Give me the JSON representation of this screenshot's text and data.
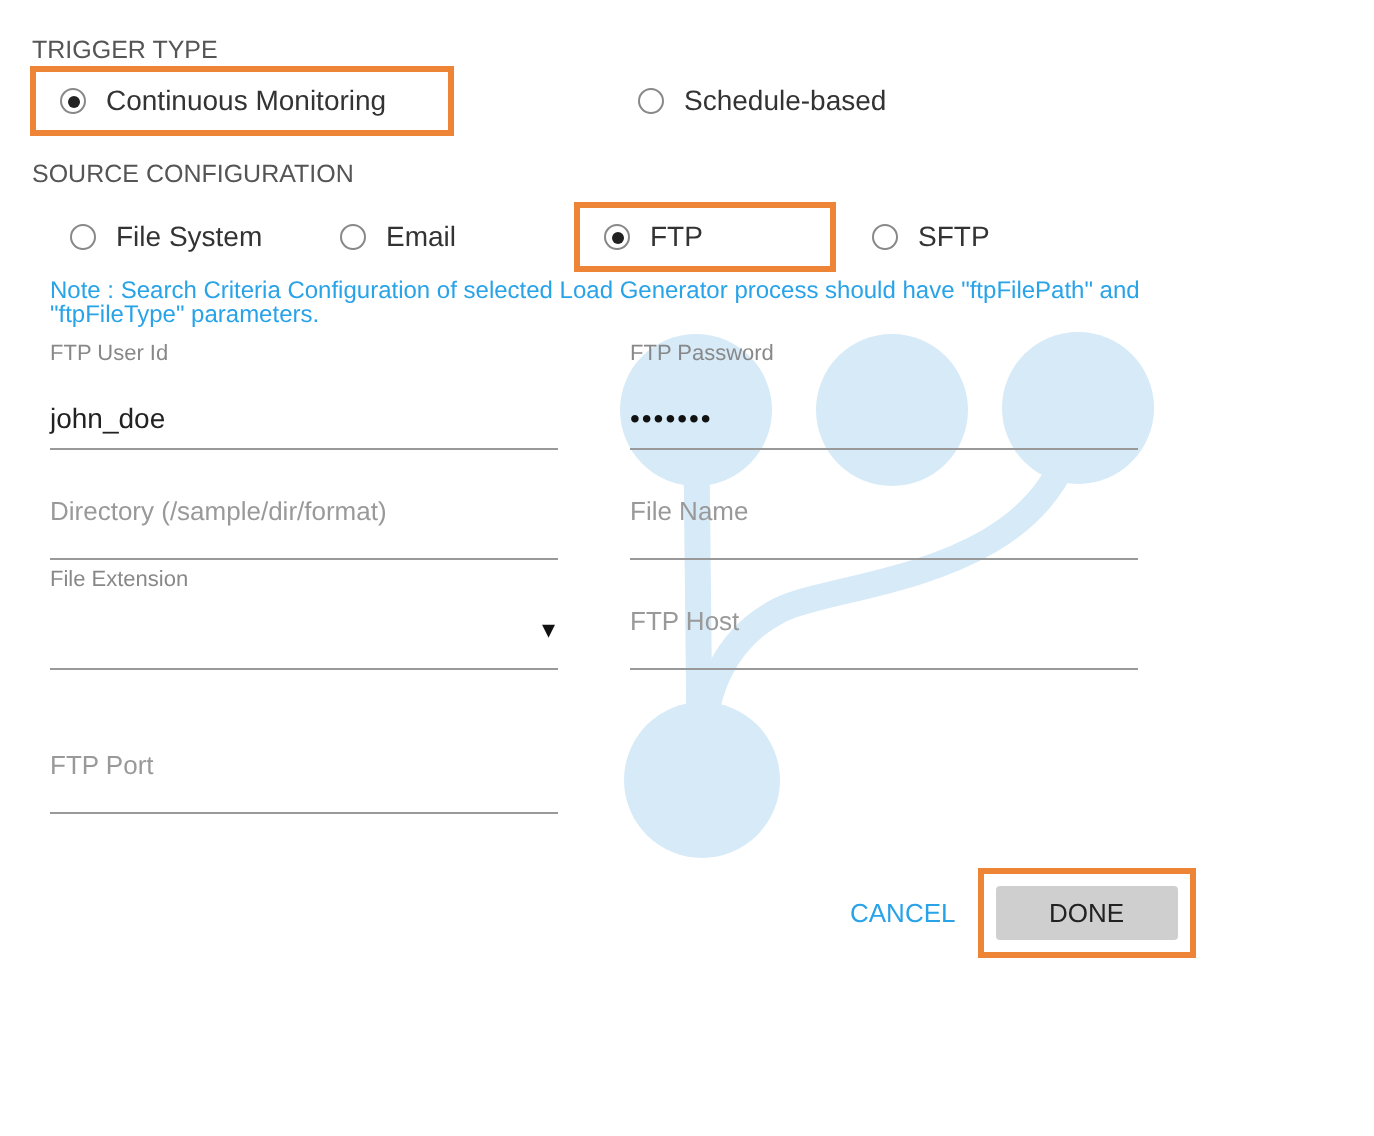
{
  "trigger_type": {
    "heading": "TRIGGER TYPE",
    "options": [
      {
        "label": "Continuous Monitoring",
        "selected": true,
        "highlighted": true
      },
      {
        "label": "Schedule-based",
        "selected": false,
        "highlighted": false
      }
    ]
  },
  "source_configuration": {
    "heading": "SOURCE CONFIGURATION",
    "options": [
      {
        "label": "File System",
        "selected": false,
        "highlighted": false
      },
      {
        "label": "Email",
        "selected": false,
        "highlighted": false
      },
      {
        "label": "FTP",
        "selected": true,
        "highlighted": true
      },
      {
        "label": "SFTP",
        "selected": false,
        "highlighted": false
      }
    ]
  },
  "note": "Note : Search Criteria Configuration of selected Load Generator process should have \"ftpFilePath\" and \"ftpFileType\" parameters.",
  "fields": [
    {
      "kind": "text",
      "label": "FTP User Id",
      "value": "john_doe"
    },
    {
      "kind": "password",
      "label": "FTP Password",
      "value": "•••••••"
    },
    {
      "kind": "empty",
      "placeholder": "Directory (/sample/dir/format)"
    },
    {
      "kind": "empty",
      "placeholder": "File Name"
    },
    {
      "kind": "select",
      "label": "File Extension",
      "caret": "▾"
    },
    {
      "kind": "empty",
      "placeholder": "FTP Host"
    },
    {
      "kind": "empty",
      "placeholder": "FTP Port"
    }
  ],
  "buttons": [
    {
      "label": "CANCEL",
      "kind": "link",
      "highlighted": false
    },
    {
      "label": "DONE",
      "kind": "raised",
      "highlighted": true
    }
  ]
}
